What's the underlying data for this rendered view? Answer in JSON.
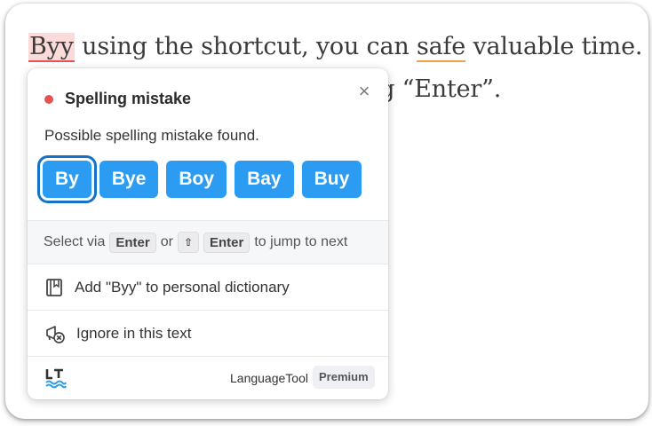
{
  "editor": {
    "line1": {
      "error_word": "Byy",
      "part1": " using the shortcut, you can ",
      "style_word": "safe",
      "part2": " valuable time."
    },
    "line2_visible": "ng “Enter”."
  },
  "popup": {
    "title": "Spelling mistake",
    "close_glyph": "×",
    "description": "Possible spelling mistake found.",
    "suggestions": [
      "By",
      "Bye",
      "Boy",
      "Bay",
      "Buy"
    ],
    "hint": {
      "prefix": "Select via",
      "key1": "Enter",
      "or": "or",
      "shift_glyph": "⇧",
      "key2": "Enter",
      "suffix": "to jump to next"
    },
    "add_to_dictionary": "Add \"Byy\" to personal dictionary",
    "ignore": "Ignore in this text",
    "brand": "LanguageTool",
    "premium": "Premium",
    "icons": {
      "dictionary": "book-icon",
      "ignore": "ignore-icon",
      "logo": "languagetool-logo-icon"
    }
  },
  "colors": {
    "error": "#e55353",
    "error_bg": "#fbdada",
    "style_underline": "#f0a24a",
    "suggestion": "#2b9cf2",
    "suggestion_focus": "#1572c9",
    "logo_blue": "#2b9cf2"
  }
}
